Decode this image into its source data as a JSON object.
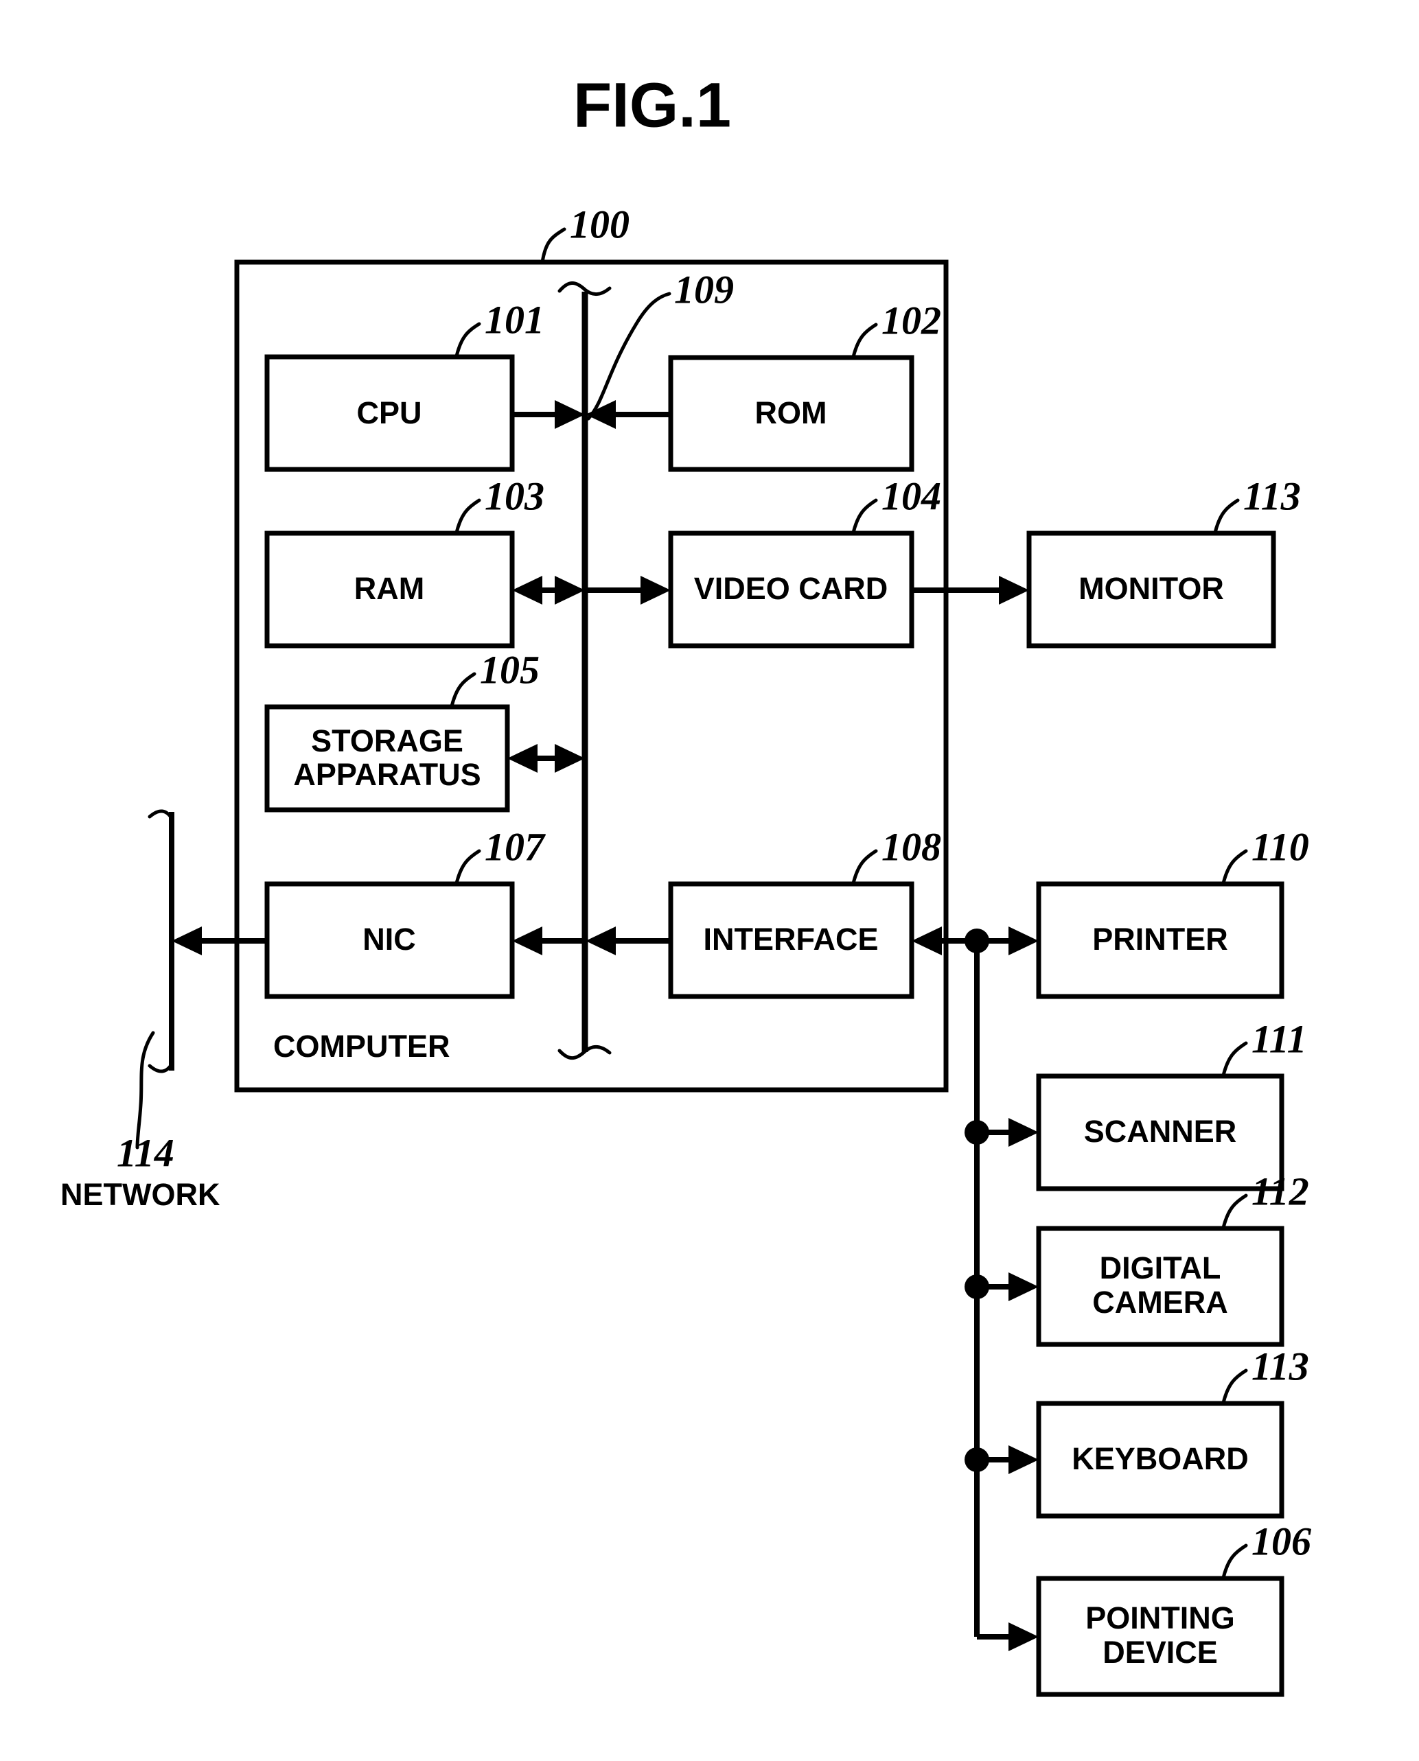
{
  "figure": {
    "title": "FIG.1",
    "enclosure_label": "COMPUTER",
    "network_label": "NETWORK"
  },
  "blocks": {
    "cpu": {
      "label": "CPU",
      "ref": "101"
    },
    "rom": {
      "label": "ROM",
      "ref": "102"
    },
    "ram": {
      "label": "RAM",
      "ref": "103"
    },
    "video_card": {
      "label": "VIDEO CARD",
      "ref": "104"
    },
    "storage": {
      "label_line1": "STORAGE",
      "label_line2": "APPARATUS",
      "ref": "105"
    },
    "nic": {
      "label": "NIC",
      "ref": "107"
    },
    "interface": {
      "label": "INTERFACE",
      "ref": "108"
    },
    "monitor": {
      "label": "MONITOR",
      "ref": "113"
    },
    "printer": {
      "label": "PRINTER",
      "ref": "110"
    },
    "scanner": {
      "label": "SCANNER",
      "ref": "111"
    },
    "digital_camera": {
      "label_line1": "DIGITAL",
      "label_line2": "CAMERA",
      "ref": "112"
    },
    "keyboard": {
      "label": "KEYBOARD",
      "ref": "113"
    },
    "pointing_device": {
      "label_line1": "POINTING",
      "label_line2": "DEVICE",
      "ref": "106"
    }
  },
  "refs": {
    "computer": "100",
    "bus": "109",
    "network": "114"
  },
  "colors": {
    "stroke": "#000000",
    "fill": "#ffffff"
  }
}
